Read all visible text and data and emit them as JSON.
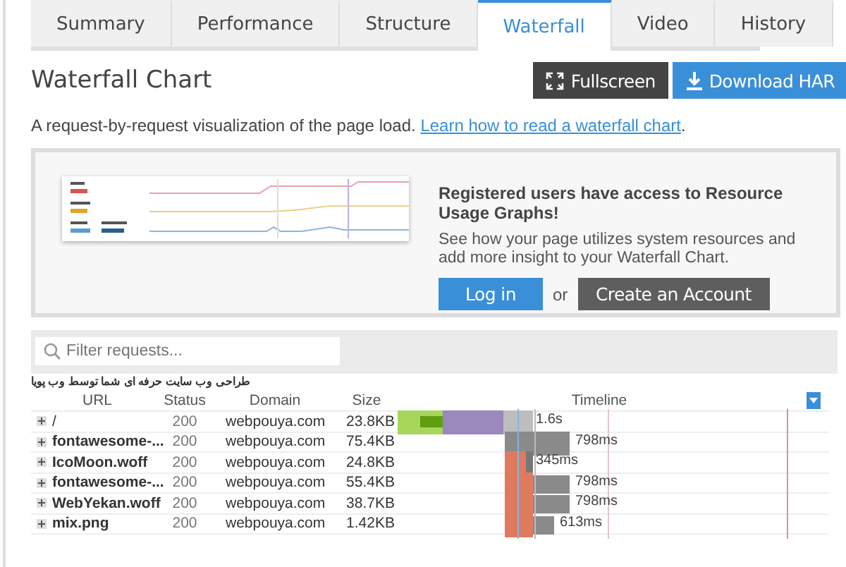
{
  "tabs": [
    {
      "label": "Summary",
      "selected": false
    },
    {
      "label": "Performance",
      "selected": false
    },
    {
      "label": "Structure",
      "selected": false
    },
    {
      "label": "Waterfall",
      "selected": true
    },
    {
      "label": "Video",
      "selected": false
    },
    {
      "label": "History",
      "selected": false
    }
  ],
  "title": "Waterfall Chart",
  "buttons": {
    "fullscreen": "Fullscreen",
    "download": "Download HAR"
  },
  "description": {
    "text": "A request-by-request visualization of the page load.",
    "link": "Learn how to read a waterfall chart",
    "end": "."
  },
  "promo": {
    "heading": "Registered users have access to Resource Usage Graphs!",
    "body": "See how your page utilizes system resources and add more insight to your Waterfall Chart.",
    "login": "Log in",
    "or": "or",
    "create": "Create an Account"
  },
  "filter": {
    "placeholder": "Filter requests..."
  },
  "table": {
    "page_title": "طراحی وب سایت حرفه ای شما توسط وب پویا",
    "columns": [
      "URL",
      "Status",
      "Domain",
      "Size",
      "Timeline"
    ],
    "rows": [
      {
        "url": "/",
        "bold": false,
        "status": "200",
        "domain": "webpouya.com",
        "size": "23.8KB",
        "timing": "1.6s",
        "kind": "document"
      },
      {
        "url": "fontawesome-...",
        "bold": true,
        "status": "200",
        "domain": "webpouya.com",
        "size": "75.4KB",
        "timing": "798ms",
        "kind": "cached"
      },
      {
        "url": "IcoMoon.woff",
        "bold": true,
        "status": "200",
        "domain": "webpouya.com",
        "size": "24.8KB",
        "timing": "345ms",
        "kind": "short"
      },
      {
        "url": "fontawesome-...",
        "bold": true,
        "status": "200",
        "domain": "webpouya.com",
        "size": "55.4KB",
        "timing": "798ms",
        "kind": "long"
      },
      {
        "url": "WebYekan.woff",
        "bold": true,
        "status": "200",
        "domain": "webpouya.com",
        "size": "38.7KB",
        "timing": "798ms",
        "kind": "long"
      },
      {
        "url": "mix.png",
        "bold": true,
        "status": "200",
        "domain": "webpouya.com",
        "size": "1.42KB",
        "timing": "613ms",
        "kind": "mid"
      }
    ]
  }
}
